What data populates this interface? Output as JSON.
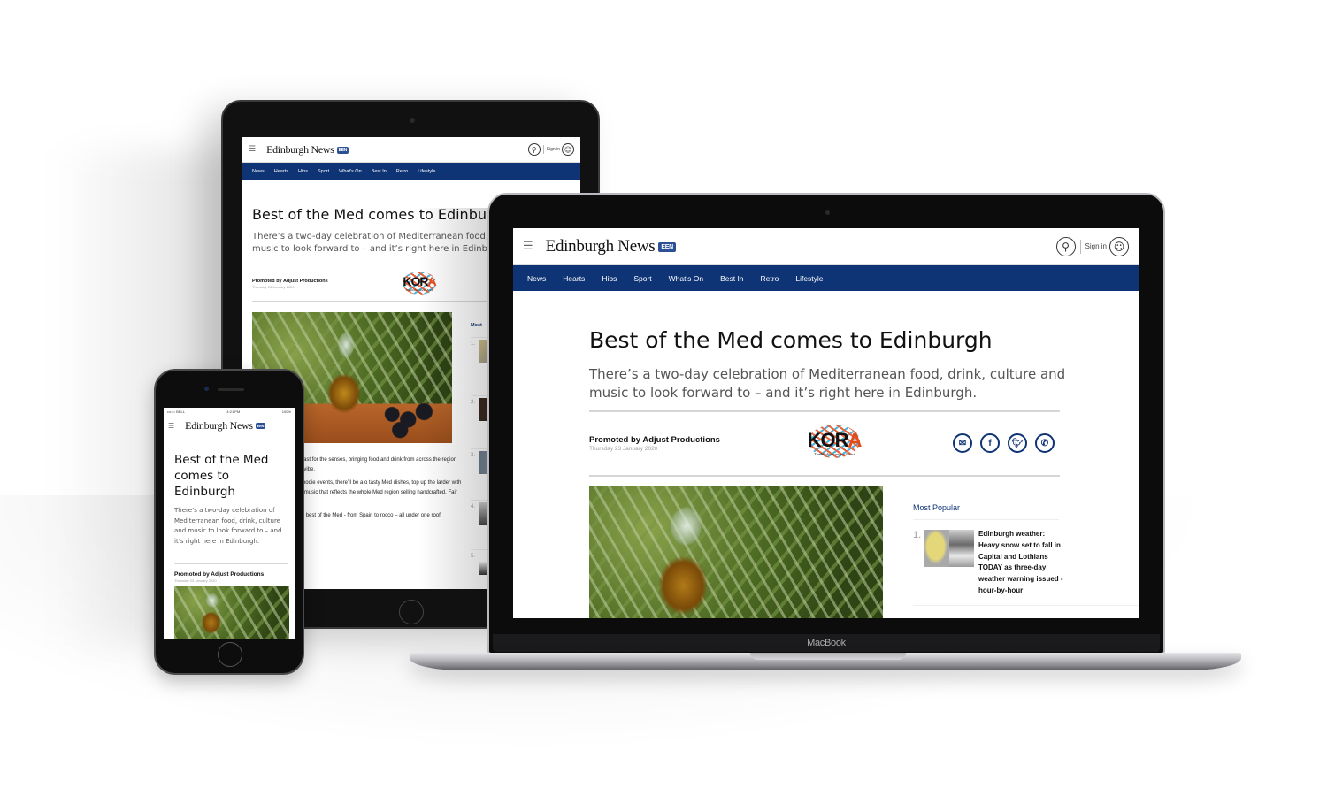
{
  "site": {
    "brand": "Edinburgh News",
    "brand_badge": "EEN",
    "sign_in": "Sign in",
    "nav_items": [
      "News",
      "Hearts",
      "Hibs",
      "Sport",
      "What's On",
      "Best In",
      "Retro",
      "Lifestyle"
    ],
    "colors": {
      "nav": "#0f3475",
      "accent": "#0f3475",
      "kora_orange": "#e34b1b",
      "kora_blue": "#2aa7d8"
    }
  },
  "article": {
    "headline": "Best of the Med comes to Edinburgh",
    "headline_tablet": "Best of the Med comes to Edinbu",
    "standfirst": "There’s a two-day celebration of Mediterranean food, drink, culture and music to look forward to – and it’s right here in Edinburgh.",
    "standfirst_tablet_line1": "There’s a two-day celebration of Mediterranean food,",
    "standfirst_tablet_line2": "music to look forward to – and it’s right here in Edinb",
    "promoted_by": "Promoted by Adjust Productions",
    "date": "Thursday 23 January 2020",
    "sponsor_logo": {
      "word_main": "KOR",
      "word_accent": "A",
      "tagline": "The Mediterranean Feast"
    },
    "share_icons": [
      "email-icon",
      "facebook-icon",
      "twitter-icon",
      "whatsapp-icon"
    ],
    "body_paragraphs_tablet": [
      "ious Mediterranean feast for the senses, bringing food and drink from across the region with stalls, t sunshine vibe.",
      "of Edinburgh’s other foodie events, there’ll be a o tasty Med dishes, top up the larder with hard to find ing to live music that reflects the whole Med region selling handcrafted, Fair Trade goodies.",
      "designed to reflect the best of the Med - from Spain to rocco – all under one roof."
    ]
  },
  "most_popular": {
    "label": "Most Popular",
    "label_tablet": "Most",
    "items": [
      {
        "rank": "1.",
        "title": "Edinburgh weather: Heavy snow set to fall in Capital and Lothians TODAY as three-day weather warning issued - hour-by-hour"
      },
      {
        "rank": "2.",
        "title": ""
      },
      {
        "rank": "3.",
        "title": ""
      },
      {
        "rank": "4.",
        "title": ""
      },
      {
        "rank": "5.",
        "title": ""
      }
    ]
  },
  "phone": {
    "carrier": "•••○○ BELL",
    "time": "4:21 PM",
    "battery": "100%"
  },
  "laptop": {
    "label": "MacBook"
  }
}
